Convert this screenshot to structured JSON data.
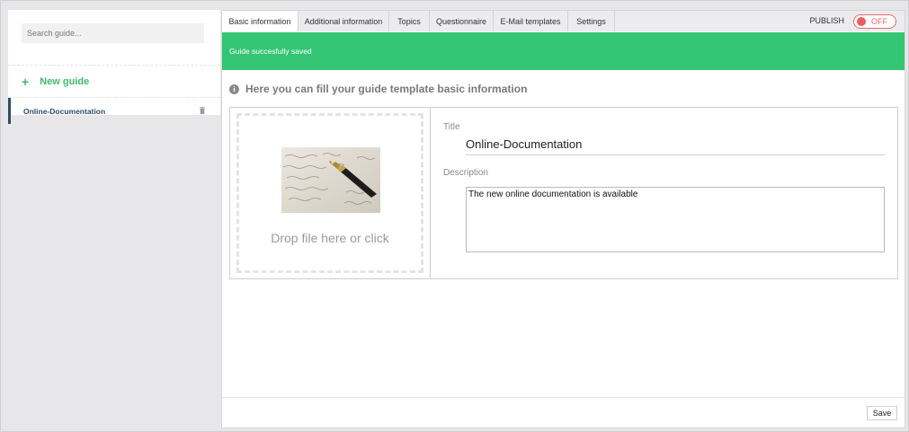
{
  "sidebar": {
    "search_placeholder": "Search guide...",
    "new_guide_label": "New guide",
    "new_guide_icon": "plus-icon",
    "items": [
      {
        "label": "Online-Documentation",
        "icon": "trash-icon"
      }
    ]
  },
  "tabs": [
    {
      "label": "Basic information",
      "active": true
    },
    {
      "label": "Additional information"
    },
    {
      "label": "Topics"
    },
    {
      "label": "Questionnaire"
    },
    {
      "label": "E-Mail templates"
    },
    {
      "label": "Settings"
    }
  ],
  "publish": {
    "label": "PUBLISH",
    "toggle_state": "OFF"
  },
  "banner": {
    "message": "Guide succesfully saved"
  },
  "form": {
    "heading": "Here you can fill your guide template basic information",
    "dropzone_text": "Drop file here or click",
    "title_label": "Title",
    "title_value": "Online-Documentation",
    "description_label": "Description",
    "description_value": "The new online documentation is available"
  },
  "footer": {
    "save_label": "Save"
  },
  "colors": {
    "accent_green": "#34c574",
    "toggle_off_red": "#ef5c5c",
    "active_item_border": "#2d4a6b"
  }
}
